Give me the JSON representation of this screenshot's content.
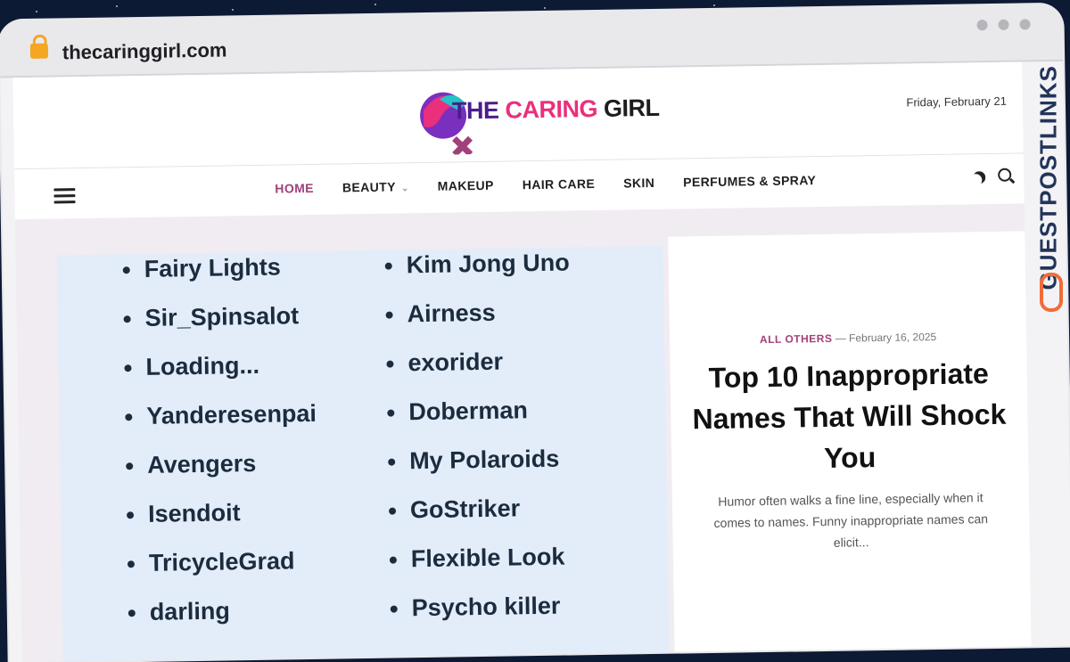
{
  "browser": {
    "url": "thecaringgirl.com"
  },
  "site": {
    "logo_the": "THE",
    "logo_caring": "CARING",
    "logo_girl": "GIRL",
    "date": "Friday, February 21"
  },
  "nav": {
    "items": [
      "HOME",
      "BEAUTY",
      "MAKEUP",
      "HAIR CARE",
      "SKIN",
      "PERFUMES & SPRAY"
    ]
  },
  "hero_list": {
    "left": [
      "Fairy Lights",
      "Sir_Spinsalot",
      "Loading...",
      "Yanderesenpai",
      "Avengers",
      "Isendoit",
      "TricycleGrad",
      "darling"
    ],
    "right": [
      "Kim Jong Uno",
      "Airness",
      "exorider",
      "Doberman",
      "My Polaroids",
      "GoStriker",
      "Flexible Look",
      "Psycho killer"
    ]
  },
  "article": {
    "category": "ALL OTHERS",
    "date": "— February 16, 2025",
    "title": "Top 10 Inappropriate Names That Will Shock You",
    "excerpt": "Humor often walks a fine line, especially when it comes to names. Funny inappropriate names can elicit..."
  },
  "watermark": {
    "label": "GUESTPOSTLINKS"
  },
  "colors": {
    "accent": "#a0417a",
    "brand_pink": "#ea2f7d",
    "brand_purple": "#4b1e8a"
  }
}
